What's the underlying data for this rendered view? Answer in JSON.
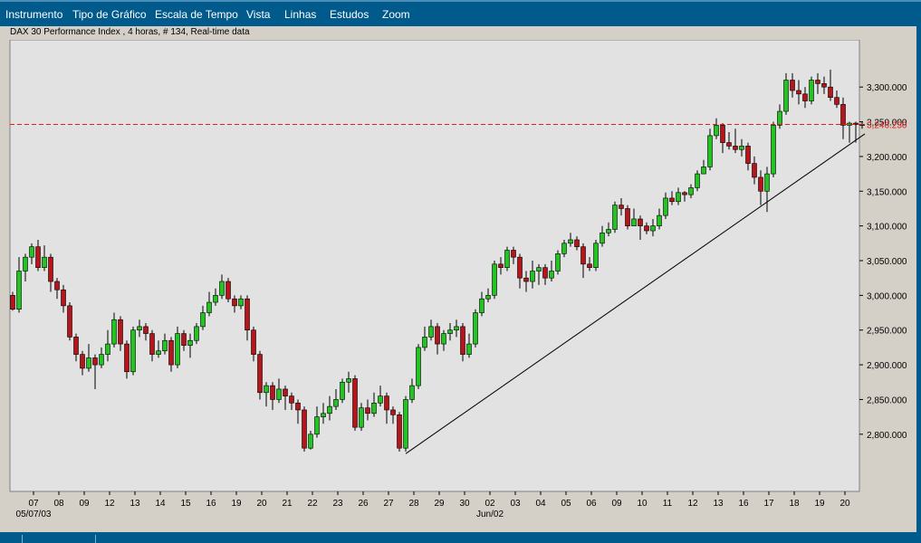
{
  "menu": {
    "items": [
      "Instrumento",
      "Tipo de Gráfico",
      "Escala de Tempo",
      "Vista",
      "Linhas",
      "Estudos",
      "Zoom"
    ]
  },
  "chart_header": {
    "title": "DAX 30 Performance Index , 4 horas, # 134, Real-time data"
  },
  "colors": {
    "up": "#22c322",
    "down": "#b4161c",
    "plot_bg": "#e2e2e2",
    "menubar": "#005a8c",
    "reference_line": "#e31b1b"
  },
  "chart_data": {
    "type": "candlestick",
    "title": "DAX 30 Performance Index",
    "timeframe": "4 horas",
    "ylim": [
      2735,
      3360
    ],
    "y_ticks": [
      "3,300.000",
      "3,250.000",
      "3,200.000",
      "3,150.000",
      "3,100.000",
      "3,050.000",
      "3,000.000",
      "2,950.000",
      "2,900.000",
      "2,850.000",
      "2,800.000"
    ],
    "y_tick_values": [
      3300,
      3250,
      3200,
      3150,
      3100,
      3050,
      3000,
      2950,
      2900,
      2850,
      2800
    ],
    "x_tick_labels": [
      "07",
      "08",
      "09",
      "12",
      "13",
      "14",
      "15",
      "16",
      "19",
      "20",
      "21",
      "22",
      "23",
      "26",
      "27",
      "28",
      "29",
      "30",
      "02",
      "03",
      "04",
      "05",
      "06",
      "09",
      "10",
      "11",
      "12",
      "13",
      "16",
      "17",
      "18",
      "19",
      "20"
    ],
    "x_period_labels": [
      {
        "text": "05/07/03",
        "under_tick": 0
      },
      {
        "text": "Jun/02",
        "under_tick": 18
      }
    ],
    "current_price": 3246.23,
    "current_price_label": "3,246.230",
    "trendline": {
      "from": {
        "bar": 62,
        "price": 2772
      },
      "to": {
        "bar": 133,
        "price": 3226
      }
    },
    "candles": [
      [
        3000,
        2980,
        3005,
        2978
      ],
      [
        2980,
        3035,
        3055,
        2975
      ],
      [
        3035,
        3055,
        3060,
        3020
      ],
      [
        3055,
        3070,
        3075,
        3045
      ],
      [
        3070,
        3040,
        3080,
        3035
      ],
      [
        3040,
        3055,
        3072,
        3035
      ],
      [
        3055,
        3020,
        3060,
        3005
      ],
      [
        3020,
        3008,
        3025,
        2995
      ],
      [
        3008,
        2985,
        3015,
        2975
      ],
      [
        2985,
        2940,
        2990,
        2935
      ],
      [
        2940,
        2915,
        2945,
        2905
      ],
      [
        2915,
        2895,
        2920,
        2885
      ],
      [
        2895,
        2910,
        2930,
        2890
      ],
      [
        2910,
        2900,
        2915,
        2865
      ],
      [
        2900,
        2915,
        2925,
        2895
      ],
      [
        2915,
        2930,
        2950,
        2905
      ],
      [
        2930,
        2965,
        2975,
        2925
      ],
      [
        2965,
        2930,
        2970,
        2920
      ],
      [
        2930,
        2890,
        2935,
        2880
      ],
      [
        2890,
        2950,
        2955,
        2885
      ],
      [
        2950,
        2955,
        2965,
        2940
      ],
      [
        2955,
        2945,
        2960,
        2935
      ],
      [
        2945,
        2915,
        2950,
        2905
      ],
      [
        2915,
        2920,
        2935,
        2910
      ],
      [
        2920,
        2935,
        2945,
        2915
      ],
      [
        2935,
        2900,
        2940,
        2890
      ],
      [
        2900,
        2945,
        2955,
        2895
      ],
      [
        2945,
        2928,
        2950,
        2920
      ],
      [
        2928,
        2935,
        2945,
        2910
      ],
      [
        2935,
        2955,
        2960,
        2930
      ],
      [
        2955,
        2975,
        2985,
        2950
      ],
      [
        2975,
        2990,
        3005,
        2970
      ],
      [
        2990,
        3000,
        3010,
        2985
      ],
      [
        3000,
        3020,
        3030,
        2995
      ],
      [
        3020,
        2995,
        3025,
        2990
      ],
      [
        2995,
        2985,
        3000,
        2975
      ],
      [
        2985,
        2995,
        3000,
        2980
      ],
      [
        2995,
        2950,
        3000,
        2935
      ],
      [
        2950,
        2915,
        2955,
        2905
      ],
      [
        2915,
        2860,
        2920,
        2850
      ],
      [
        2860,
        2870,
        2875,
        2840
      ],
      [
        2870,
        2850,
        2875,
        2835
      ],
      [
        2850,
        2865,
        2880,
        2845
      ],
      [
        2865,
        2855,
        2870,
        2835
      ],
      [
        2855,
        2845,
        2860,
        2835
      ],
      [
        2845,
        2835,
        2850,
        2815
      ],
      [
        2835,
        2780,
        2840,
        2775
      ],
      [
        2780,
        2800,
        2805,
        2778
      ],
      [
        2800,
        2825,
        2840,
        2795
      ],
      [
        2825,
        2830,
        2845,
        2815
      ],
      [
        2830,
        2840,
        2855,
        2820
      ],
      [
        2840,
        2850,
        2865,
        2835
      ],
      [
        2850,
        2875,
        2880,
        2845
      ],
      [
        2875,
        2880,
        2890,
        2860
      ],
      [
        2880,
        2810,
        2885,
        2805
      ],
      [
        2810,
        2838,
        2845,
        2805
      ],
      [
        2838,
        2830,
        2850,
        2820
      ],
      [
        2830,
        2845,
        2860,
        2825
      ],
      [
        2845,
        2855,
        2870,
        2840
      ],
      [
        2855,
        2835,
        2860,
        2815
      ],
      [
        2835,
        2828,
        2840,
        2815
      ],
      [
        2828,
        2780,
        2832,
        2775
      ],
      [
        2780,
        2850,
        2855,
        2775
      ],
      [
        2850,
        2870,
        2880,
        2845
      ],
      [
        2870,
        2925,
        2930,
        2865
      ],
      [
        2925,
        2940,
        2955,
        2920
      ],
      [
        2940,
        2955,
        2965,
        2935
      ],
      [
        2955,
        2930,
        2960,
        2915
      ],
      [
        2930,
        2945,
        2950,
        2920
      ],
      [
        2945,
        2950,
        2960,
        2935
      ],
      [
        2950,
        2955,
        2965,
        2940
      ],
      [
        2955,
        2915,
        2960,
        2905
      ],
      [
        2915,
        2930,
        2945,
        2910
      ],
      [
        2930,
        2975,
        2980,
        2925
      ],
      [
        2975,
        2995,
        3005,
        2970
      ],
      [
        2995,
        3000,
        3010,
        2990
      ],
      [
        3000,
        3045,
        3050,
        2995
      ],
      [
        3045,
        3040,
        3055,
        3030
      ],
      [
        3040,
        3065,
        3070,
        3035
      ],
      [
        3065,
        3055,
        3070,
        3045
      ],
      [
        3055,
        3025,
        3060,
        3010
      ],
      [
        3025,
        3020,
        3035,
        3005
      ],
      [
        3020,
        3035,
        3050,
        3010
      ],
      [
        3035,
        3040,
        3045,
        3015
      ],
      [
        3040,
        3025,
        3045,
        3015
      ],
      [
        3025,
        3035,
        3050,
        3020
      ],
      [
        3035,
        3060,
        3065,
        3030
      ],
      [
        3060,
        3075,
        3080,
        3055
      ],
      [
        3075,
        3080,
        3090,
        3070
      ],
      [
        3080,
        3070,
        3085,
        3065
      ],
      [
        3070,
        3045,
        3075,
        3025
      ],
      [
        3045,
        3040,
        3055,
        3035
      ],
      [
        3040,
        3075,
        3080,
        3035
      ],
      [
        3075,
        3090,
        3100,
        3070
      ],
      [
        3090,
        3095,
        3105,
        3085
      ],
      [
        3095,
        3130,
        3135,
        3090
      ],
      [
        3130,
        3125,
        3140,
        3115
      ],
      [
        3125,
        3100,
        3130,
        3095
      ],
      [
        3100,
        3110,
        3125,
        3100
      ],
      [
        3110,
        3100,
        3115,
        3080
      ],
      [
        3100,
        3093,
        3105,
        3088
      ],
      [
        3093,
        3100,
        3110,
        3085
      ],
      [
        3100,
        3115,
        3125,
        3095
      ],
      [
        3115,
        3140,
        3148,
        3110
      ],
      [
        3140,
        3135,
        3150,
        3130
      ],
      [
        3135,
        3148,
        3155,
        3130
      ],
      [
        3148,
        3145,
        3150,
        3135
      ],
      [
        3145,
        3155,
        3160,
        3140
      ],
      [
        3155,
        3175,
        3180,
        3150
      ],
      [
        3175,
        3185,
        3195,
        3175
      ],
      [
        3185,
        3230,
        3240,
        3180
      ],
      [
        3230,
        3245,
        3255,
        3225
      ],
      [
        3245,
        3220,
        3248,
        3205
      ],
      [
        3220,
        3215,
        3235,
        3210
      ],
      [
        3215,
        3210,
        3240,
        3205
      ],
      [
        3210,
        3215,
        3225,
        3200
      ],
      [
        3215,
        3190,
        3220,
        3180
      ],
      [
        3190,
        3170,
        3200,
        3160
      ],
      [
        3170,
        3150,
        3180,
        3130
      ],
      [
        3150,
        3175,
        3185,
        3120
      ],
      [
        3175,
        3245,
        3250,
        3170
      ],
      [
        3245,
        3265,
        3275,
        3240
      ],
      [
        3265,
        3310,
        3320,
        3260
      ],
      [
        3310,
        3295,
        3320,
        3285
      ],
      [
        3295,
        3290,
        3310,
        3275
      ],
      [
        3290,
        3280,
        3300,
        3270
      ],
      [
        3280,
        3310,
        3315,
        3275
      ],
      [
        3310,
        3305,
        3320,
        3290
      ],
      [
        3305,
        3300,
        3315,
        3290
      ],
      [
        3300,
        3285,
        3325,
        3280
      ],
      [
        3285,
        3275,
        3295,
        3270
      ],
      [
        3275,
        3245,
        3285,
        3225
      ],
      [
        3245,
        3248,
        3250,
        3220
      ],
      [
        3248,
        3246,
        3250,
        3220
      ],
      [
        3246,
        3245,
        3250,
        3240
      ]
    ]
  }
}
